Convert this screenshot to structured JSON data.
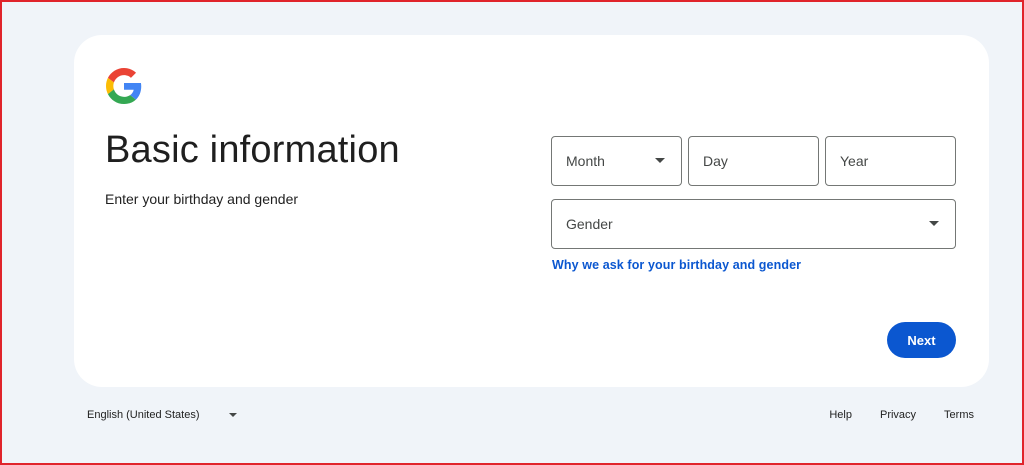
{
  "header": {
    "title": "Basic information",
    "subtitle": "Enter your birthday and gender"
  },
  "form": {
    "month_placeholder": "Month",
    "day_placeholder": "Day",
    "year_placeholder": "Year",
    "gender_placeholder": "Gender",
    "why_link": "Why we ask for your birthday and gender",
    "next_label": "Next"
  },
  "footer": {
    "language": "English (United States)",
    "help": "Help",
    "privacy": "Privacy",
    "terms": "Terms"
  },
  "icons": {
    "logo": "google-logo-icon",
    "dropdown": "caret-down-icon"
  },
  "colors": {
    "accent": "#0b57d0",
    "background": "#f0f4f9",
    "card": "#ffffff"
  }
}
